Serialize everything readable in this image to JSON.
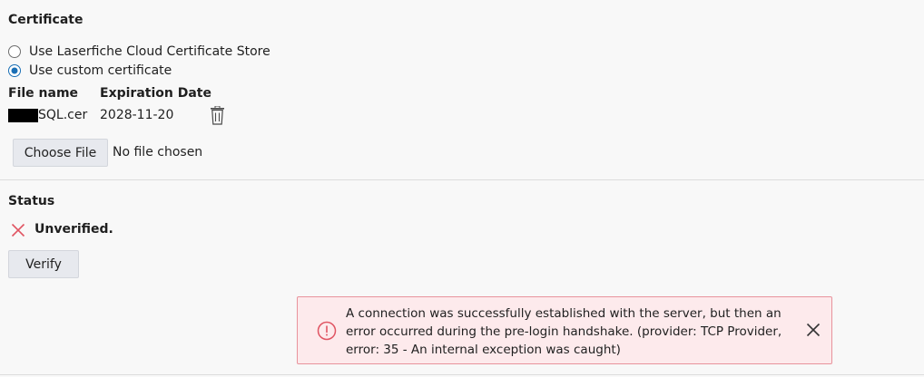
{
  "certificate": {
    "title": "Certificate",
    "options": [
      {
        "label": "Use Laserfiche Cloud Certificate Store",
        "checked": false
      },
      {
        "label": "Use custom certificate",
        "checked": true
      }
    ],
    "columns": {
      "file_name": "File name",
      "expiration": "Expiration Date"
    },
    "file": {
      "name_visible": "SQL.cer",
      "expiration": "2028-11-20"
    },
    "choose_file_label": "Choose File",
    "no_file_text": "No file chosen"
  },
  "status": {
    "title": "Status",
    "state_text": "Unverified.",
    "verify_label": "Verify"
  },
  "alert": {
    "line1": "A connection was successfully established with the server, but then an",
    "line2": "error occurred during the pre-login handshake. (provider: TCP Provider,",
    "line3": "error: 35 - An internal exception was caught)"
  },
  "colors": {
    "accent": "#1a6fb5",
    "error_icon": "#e05462",
    "alert_bg": "#fdeaec",
    "alert_border": "#e8939c"
  },
  "icons": {
    "trash": "trash-icon",
    "unverified": "x-icon",
    "alert": "exclamation-circle-icon",
    "close": "close-icon"
  }
}
